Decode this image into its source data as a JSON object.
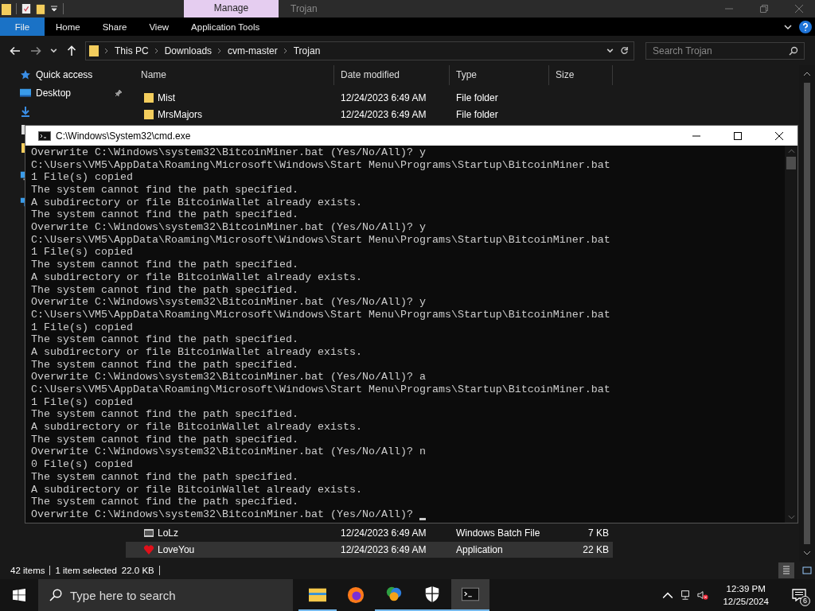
{
  "explorer": {
    "context_tab": "Manage",
    "window_title": "Trojan",
    "ribbon_tabs": [
      {
        "label": "File",
        "kind": "file"
      },
      {
        "label": "Home",
        "kind": "tab"
      },
      {
        "label": "Share",
        "kind": "tab"
      },
      {
        "label": "View",
        "kind": "tab"
      },
      {
        "label": "Application Tools",
        "kind": "tab"
      }
    ],
    "address": [
      "This PC",
      "Downloads",
      "cvm-master",
      "Trojan"
    ],
    "search": {
      "placeholder": "Search Trojan"
    },
    "nav": [
      {
        "label": "Quick access",
        "kind": "star",
        "pinned": false
      },
      {
        "label": "Desktop",
        "kind": "desktop",
        "pinned": true
      }
    ],
    "columns": [
      "Name",
      "Date modified",
      "Type",
      "Size"
    ],
    "files_top": [
      {
        "name": "Mist",
        "date": "12/24/2023 6:49 AM",
        "type": "File folder",
        "kind": "folder",
        "selected": false
      },
      {
        "name": "MrsMajors",
        "date": "12/24/2023 6:49 AM",
        "type": "File folder",
        "kind": "folder",
        "selected": false
      }
    ],
    "files_bottom": [
      {
        "name": "LoLz",
        "date": "12/24/2023 6:49 AM",
        "type": "Windows Batch File",
        "size": "7 KB",
        "kind": "batch",
        "selected": false
      },
      {
        "name": "LoveYou",
        "date": "12/24/2023 6:49 AM",
        "type": "Application",
        "size": "22 KB",
        "kind": "heart",
        "selected": true
      }
    ],
    "status": {
      "items": "42 items",
      "selection": "1 item selected",
      "size": "22.0 KB"
    }
  },
  "console": {
    "title": "C:\\Windows\\System32\\cmd.exe",
    "lines": [
      "Overwrite C:\\Windows\\system32\\BitcoinMiner.bat (Yes/No/All)? y",
      "C:\\Users\\VM5\\AppData\\Roaming\\Microsoft\\Windows\\Start Menu\\Programs\\Startup\\BitcoinMiner.bat",
      "1 File(s) copied",
      "The system cannot find the path specified.",
      "A subdirectory or file BitcoinWallet already exists.",
      "The system cannot find the path specified.",
      "Overwrite C:\\Windows\\system32\\BitcoinMiner.bat (Yes/No/All)? y",
      "C:\\Users\\VM5\\AppData\\Roaming\\Microsoft\\Windows\\Start Menu\\Programs\\Startup\\BitcoinMiner.bat",
      "1 File(s) copied",
      "The system cannot find the path specified.",
      "A subdirectory or file BitcoinWallet already exists.",
      "The system cannot find the path specified.",
      "Overwrite C:\\Windows\\system32\\BitcoinMiner.bat (Yes/No/All)? y",
      "C:\\Users\\VM5\\AppData\\Roaming\\Microsoft\\Windows\\Start Menu\\Programs\\Startup\\BitcoinMiner.bat",
      "1 File(s) copied",
      "The system cannot find the path specified.",
      "A subdirectory or file BitcoinWallet already exists.",
      "The system cannot find the path specified.",
      "Overwrite C:\\Windows\\system32\\BitcoinMiner.bat (Yes/No/All)? a",
      "C:\\Users\\VM5\\AppData\\Roaming\\Microsoft\\Windows\\Start Menu\\Programs\\Startup\\BitcoinMiner.bat",
      "1 File(s) copied",
      "The system cannot find the path specified.",
      "A subdirectory or file BitcoinWallet already exists.",
      "The system cannot find the path specified.",
      "Overwrite C:\\Windows\\system32\\BitcoinMiner.bat (Yes/No/All)? n",
      "0 File(s) copied",
      "The system cannot find the path specified.",
      "A subdirectory or file BitcoinWallet already exists.",
      "The system cannot find the path specified.",
      "Overwrite C:\\Windows\\system32\\BitcoinMiner.bat (Yes/No/All)?"
    ]
  },
  "taskbar": {
    "search_placeholder": "Type here to search",
    "apps": [
      {
        "kind": "explorer",
        "running": true,
        "selected": false
      },
      {
        "kind": "firefox",
        "running": false,
        "selected": false
      },
      {
        "kind": "photos",
        "running": true,
        "selected": false
      },
      {
        "kind": "shield",
        "running": true,
        "selected": false
      },
      {
        "kind": "console",
        "running": true,
        "selected": true
      }
    ],
    "time": "12:39 PM",
    "date": "12/25/2024",
    "notifications": "6"
  }
}
